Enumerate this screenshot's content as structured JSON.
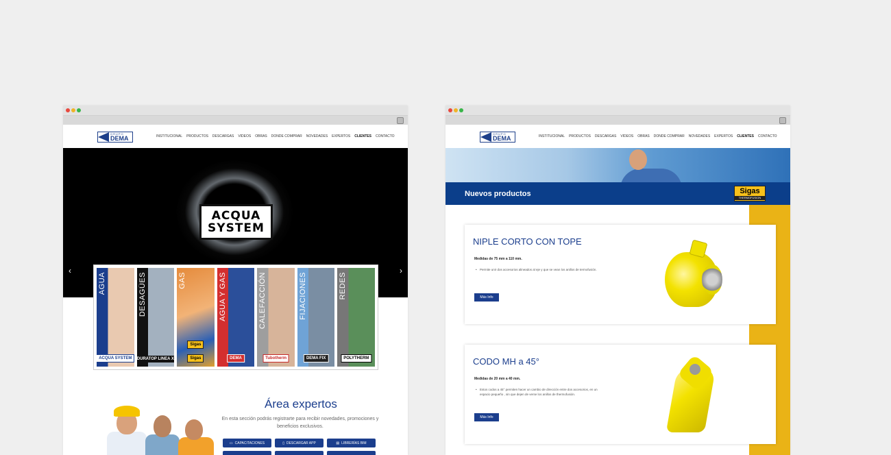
{
  "colors": {
    "brand_blue": "#1b3e8d",
    "band_blue": "#0b3e8a",
    "accent_yellow": "#eab316",
    "close": "#e8493f",
    "minimize": "#f0b429",
    "maximize": "#39b54a"
  },
  "nav": {
    "logo_top": "GRUPO",
    "logo_main": "DEMA",
    "items": [
      "INSTITUCIONAL",
      "PRODUCTOS",
      "DESCARGAS",
      "VIDEOS",
      "OBRAS",
      "DONDE COMPRAR",
      "NOVEDADES",
      "EXPERTOS",
      "CLIENTES",
      "CONTACTO"
    ],
    "active_item": "CLIENTES"
  },
  "left": {
    "hero_logo_line1": "ACQUA",
    "hero_logo_line2": "SYSTEM",
    "prev_arrow": "‹",
    "next_arrow": "›",
    "categories": [
      {
        "label": "AGUA",
        "brand": "ACQUA SYSTEM"
      },
      {
        "label": "DESAGÜES",
        "brand": "DURATOP LINEA X"
      },
      {
        "label": "GAS",
        "brand": "Sigas",
        "brand2": "Sigas"
      },
      {
        "label": "AGUA Y GAS",
        "brand": "DEMA"
      },
      {
        "label": "CALEFACCIÓN",
        "brand": "Tubotherm"
      },
      {
        "label": "FIJACIONES",
        "brand": "DEMA FIX"
      },
      {
        "label": "REDES",
        "brand": "POLYTHERM"
      }
    ],
    "experts": {
      "title": "Área expertos",
      "text": "En esta sección podrás registrarte para recibir novedades, promociones y beneficios exclusivos.",
      "buttons": [
        "CAPACITACIONES",
        "DESCARGAR APP",
        "LIBRERÍAS BIM"
      ]
    }
  },
  "right": {
    "band_title": "Nuevos productos",
    "band_logo": "Sigas",
    "band_logo_sub": "THERMOFUSION",
    "cards": [
      {
        "title": "NIPLE CORTO CON TOPE",
        "subtitle": "Medidas de 75 mm a 110 mm.",
        "description": "Permite unir dos accesorios alineados al eje y que se vean los anillos de termofusión.",
        "button": "Más Info"
      },
      {
        "title": "CODO MH a 45°",
        "subtitle": "Medidas de 20 mm a 40 mm.",
        "description": "Estos codos a 45° permiten hacer un cambio de dirección entre dos accesorios, en un espacio pequeño , sin que dejen de verse los anillos de thermofusión.",
        "button": "Más Info"
      }
    ]
  }
}
